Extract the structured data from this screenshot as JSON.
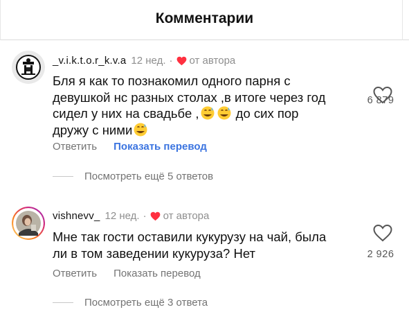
{
  "header": {
    "title": "Комментарии"
  },
  "comments": [
    {
      "username": "_v.i.k.t.o.r_k.v.a",
      "age": "12 нед.",
      "separator": "·",
      "liked_by_author_label": "от автора",
      "text_lines": [
        "Бля я как то познакомил одного парня с",
        "девушкой нс разных столах ,в итоге через год",
        "сидел у них на свадьбе ,",
        "до сих пор",
        "дружу с ними"
      ],
      "emoji": "grinning-sweat-emoji",
      "like_count": "6 879",
      "reply_label": "Ответить",
      "translate_label": "Показать перевод",
      "more_replies_label": "Посмотреть ещё 5 ответов"
    },
    {
      "username": "vishnevv_",
      "age": "12 нед.",
      "separator": "·",
      "liked_by_author_label": "от автора",
      "text_lines": [
        "Мне так гости оставили кукурузу на чай, была",
        "ли в том заведении кукуруза? Нет"
      ],
      "like_count": "2 926",
      "reply_label": "Ответить",
      "translate_label": "Показать перевод",
      "more_replies_label": "Посмотреть ещё 3 ответа"
    }
  ],
  "colors": {
    "heart_red": "#ff3040",
    "translate_blue": "#3b74e0",
    "muted_grey": "#8e8e8e",
    "story_ring_gradient": [
      "#feda75",
      "#fa7e1e",
      "#d62976",
      "#962fbf"
    ]
  }
}
